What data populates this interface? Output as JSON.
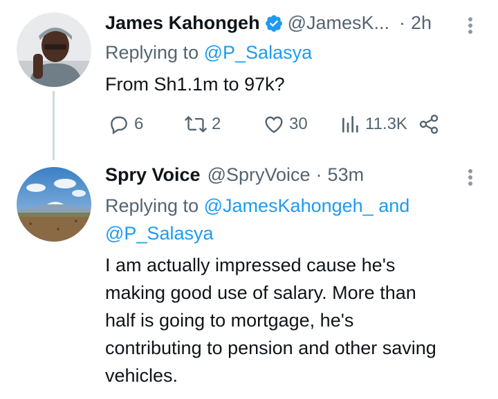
{
  "tweet1": {
    "name": "James Kahongeh",
    "handle": "@JamesK...",
    "dot": "·",
    "time": "2h",
    "reply_prefix": "Replying to",
    "reply_to": "@P_Salasya",
    "text": "From Sh1.1m to 97k?",
    "actions": {
      "replies": "6",
      "retweets": "2",
      "likes": "30",
      "views": "11.3K"
    }
  },
  "tweet2": {
    "name": "Spry Voice",
    "handle": "@SpryVoice",
    "dot": "·",
    "time": "53m",
    "reply_prefix": "Replying to",
    "reply_to_1": "@JamesKahongeh_",
    "reply_and": "and",
    "reply_to_2": "@P_Salasya",
    "text_lines": [
      "I am actually impressed cause he's",
      "making good use of salary. More than",
      "half is going to mortgage, he's",
      "contributing to pension and other saving",
      "vehicles."
    ]
  },
  "colors": {
    "link": "#1d9bf0",
    "muted": "#536471",
    "text": "#0f1419",
    "thread_line": "#cfd9de"
  },
  "icons": [
    "verified-badge-icon",
    "more-icon",
    "reply-icon",
    "retweet-icon",
    "like-icon",
    "views-icon",
    "share-icon"
  ]
}
